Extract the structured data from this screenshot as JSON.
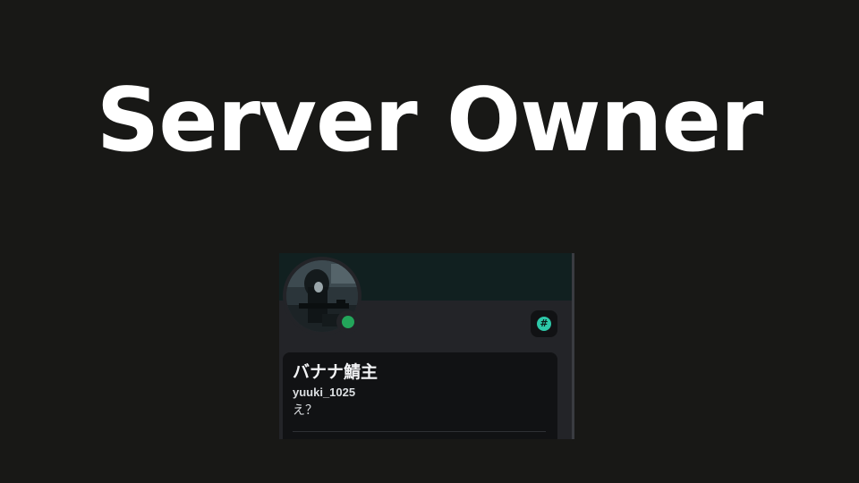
{
  "title": "Server Owner",
  "profile": {
    "display_name": "バナナ鯖主",
    "username": "yuuki_1025",
    "custom_status": "え？",
    "status": "online",
    "badge_icon": "hash-icon",
    "badge_symbol": "#",
    "colors": {
      "banner": "#112020",
      "card": "#232428",
      "inner_box": "#111214",
      "status_online": "#23a55a",
      "badge_accent": "#2dc7a8"
    }
  }
}
